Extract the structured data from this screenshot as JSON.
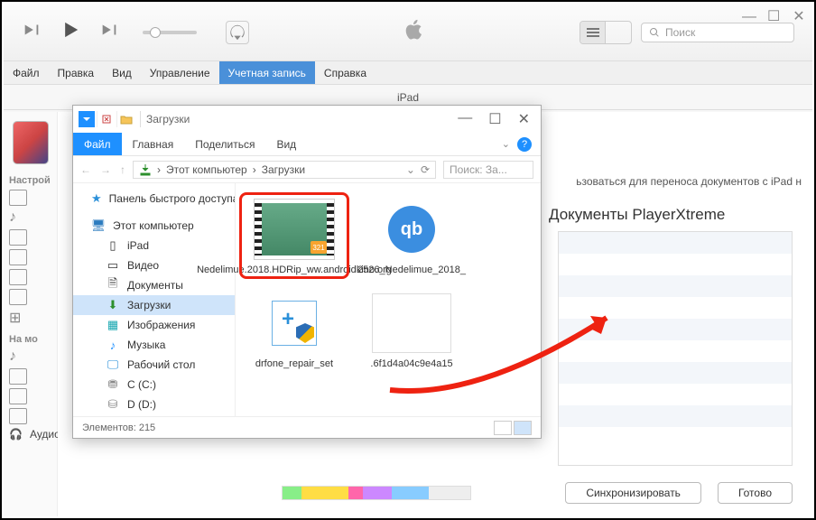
{
  "itunes": {
    "search_placeholder": "Поиск",
    "menu": [
      "Файл",
      "Правка",
      "Вид",
      "Управление",
      "Учетная запись",
      "Справка"
    ],
    "active_menu_index": 4,
    "center_tab": "iPad",
    "sidebar": {
      "section1": "Настрой",
      "section2": "На мо",
      "items": [
        "Аудиокниги"
      ]
    },
    "info_text": "ьзоваться для переноса документов с iPad н",
    "docs_title": "Документы PlayerXtreme",
    "sync_btn": "Синхронизировать",
    "done_btn": "Готово"
  },
  "explorer": {
    "title": "Загрузки",
    "tabs": {
      "file": "Файл",
      "home": "Главная",
      "share": "Поделиться",
      "view": "Вид"
    },
    "breadcrumb": [
      "Этот компьютер",
      "Загрузки"
    ],
    "search_placeholder": "Поиск: За...",
    "nav": {
      "quick": "Панель быстрого доступа",
      "pc": "Этот компьютер",
      "items": [
        "iPad",
        "Видео",
        "Документы",
        "Загрузки",
        "Изображения",
        "Музыка",
        "Рабочий стол",
        "C (C:)",
        "D (D:)"
      ]
    },
    "files": [
      {
        "name": "Nedelimue.2018.HDRip_ww.androidkino.org",
        "kind": "video"
      },
      {
        "name": "2526_Nedelimue_2018_",
        "kind": "qb"
      },
      {
        "name": "drfone_repair_set",
        "kind": "drfone"
      },
      {
        "name": ".6f1d4a04c9e4a15",
        "kind": "blank"
      }
    ],
    "status": "Элементов: 215"
  }
}
